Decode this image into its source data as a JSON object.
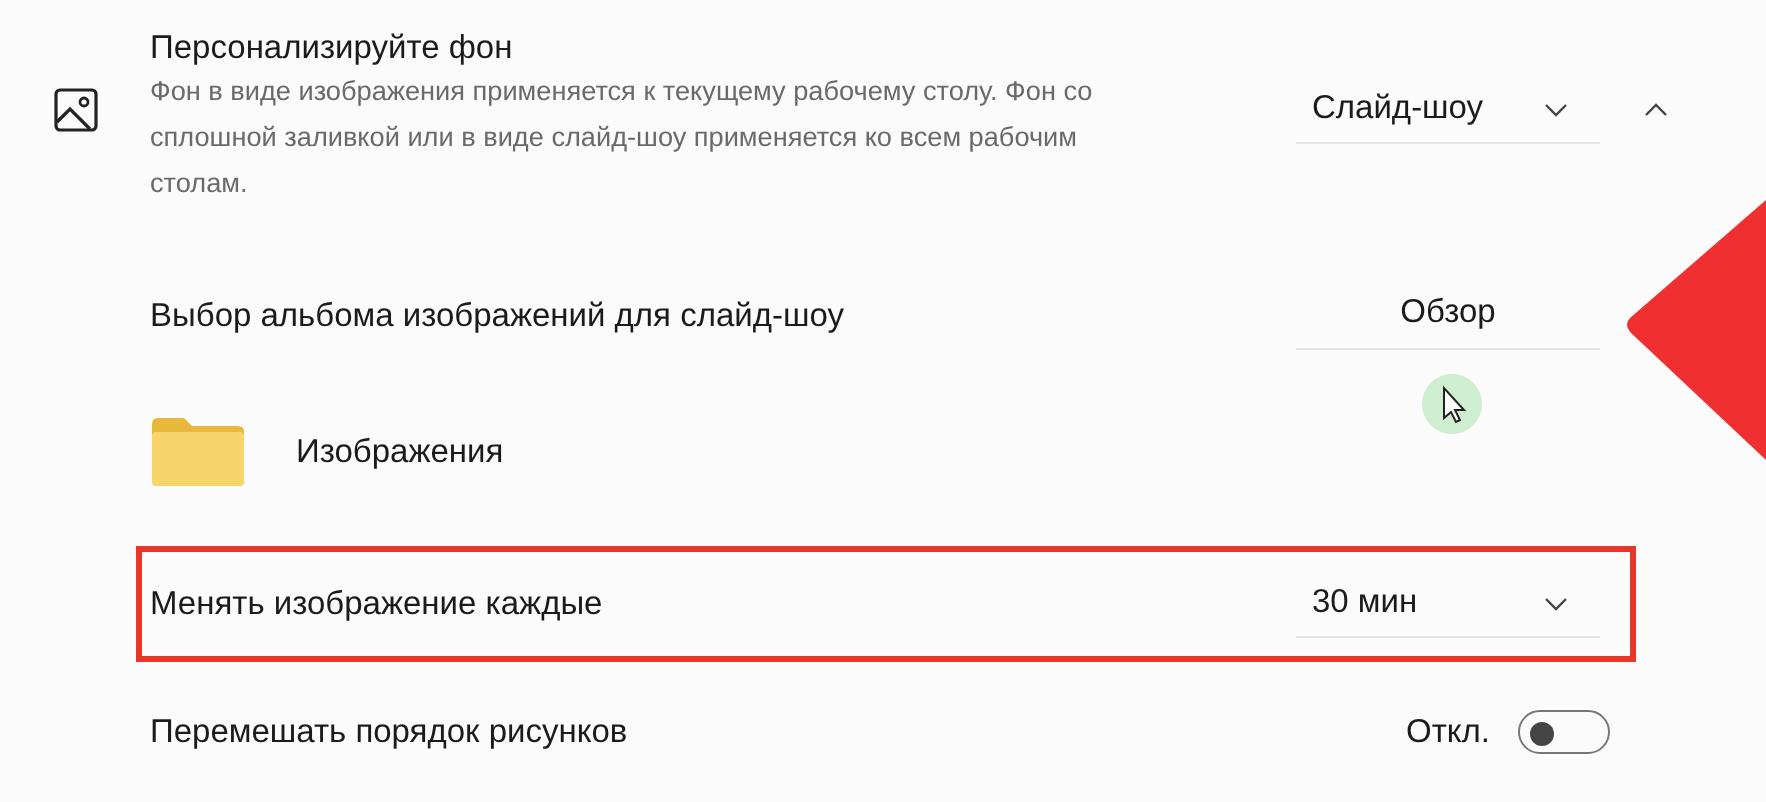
{
  "background_setting": {
    "title": "Персонализируйте фон",
    "description": "Фон в виде изображения применяется к текущему рабочему столу. Фон со сплошной заливкой или в виде слайд-шоу применяется ко всем рабочим столам.",
    "value": "Слайд-шоу",
    "expanded": true
  },
  "rows": [
    {
      "kind": "button",
      "label": "Выбор альбома изображений для слайд-шоу",
      "value": "Обзор",
      "highlighted": false
    },
    {
      "kind": "folder",
      "label": "Изображения",
      "highlighted": false
    },
    {
      "kind": "dropdown",
      "label": "Менять изображение каждые",
      "value": "30 мин",
      "highlighted": true
    },
    {
      "kind": "toggle",
      "label": "Перемешать порядок рисунков",
      "value": "Откл.",
      "on": false,
      "highlighted": false
    }
  ]
}
